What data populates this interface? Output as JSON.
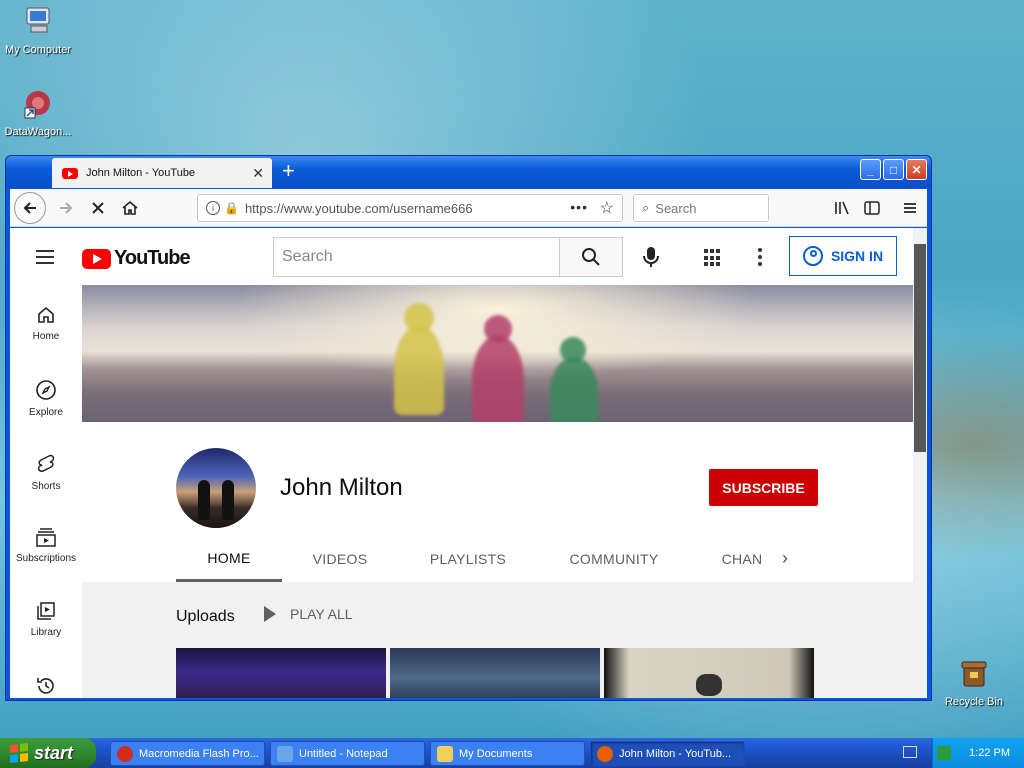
{
  "desktop": {
    "icons": [
      {
        "label": "My Computer",
        "icon": "my-computer-icon"
      },
      {
        "label": "DataWagon...",
        "icon": "datawagon-icon"
      },
      {
        "label": "Recycle Bin",
        "icon": "recycle-bin-icon"
      }
    ]
  },
  "browser": {
    "tab_title": "John Milton - YouTube",
    "new_tab": "+",
    "url": "https://www.youtube.com/username666",
    "search_placeholder": "Search",
    "window_buttons": {
      "minimize": "_",
      "maximize": "□",
      "close": "✕"
    }
  },
  "youtube": {
    "logo_text": "YouTube",
    "search_placeholder": "Search",
    "sign_in_label": "SIGN IN",
    "rail": [
      {
        "label": "Home",
        "icon": "home-icon"
      },
      {
        "label": "Explore",
        "icon": "compass-icon"
      },
      {
        "label": "Shorts",
        "icon": "shorts-icon"
      },
      {
        "label": "Subscriptions",
        "icon": "subscriptions-icon"
      },
      {
        "label": "Library",
        "icon": "library-icon"
      },
      {
        "label": "",
        "icon": "history-icon"
      }
    ],
    "channel": {
      "name": "John Milton",
      "subscribe_label": "SUBSCRIBE",
      "tabs": [
        "HOME",
        "VIDEOS",
        "PLAYLISTS",
        "COMMUNITY",
        "CHAN"
      ],
      "active_tab": "HOME"
    },
    "uploads": {
      "title": "Uploads",
      "play_all_label": "PLAY ALL"
    }
  },
  "taskbar": {
    "start_label": "start",
    "items": [
      {
        "label": "Macromedia Flash Pro...",
        "icon": "flash-icon",
        "color": "#d22c1c"
      },
      {
        "label": "Untitled - Notepad",
        "icon": "notepad-icon",
        "color": "#6aa7e8"
      },
      {
        "label": "My Documents",
        "icon": "folder-icon",
        "color": "#f2cf5b"
      },
      {
        "label": "John Milton - YouTub...",
        "icon": "firefox-icon",
        "color": "#e66000"
      }
    ],
    "clock": "1:22 PM"
  },
  "colors": {
    "xp_blue": "#0a55e0",
    "yt_red": "#ff0000",
    "subscribe_red": "#cc0000",
    "sign_in_blue": "#065fd4"
  }
}
